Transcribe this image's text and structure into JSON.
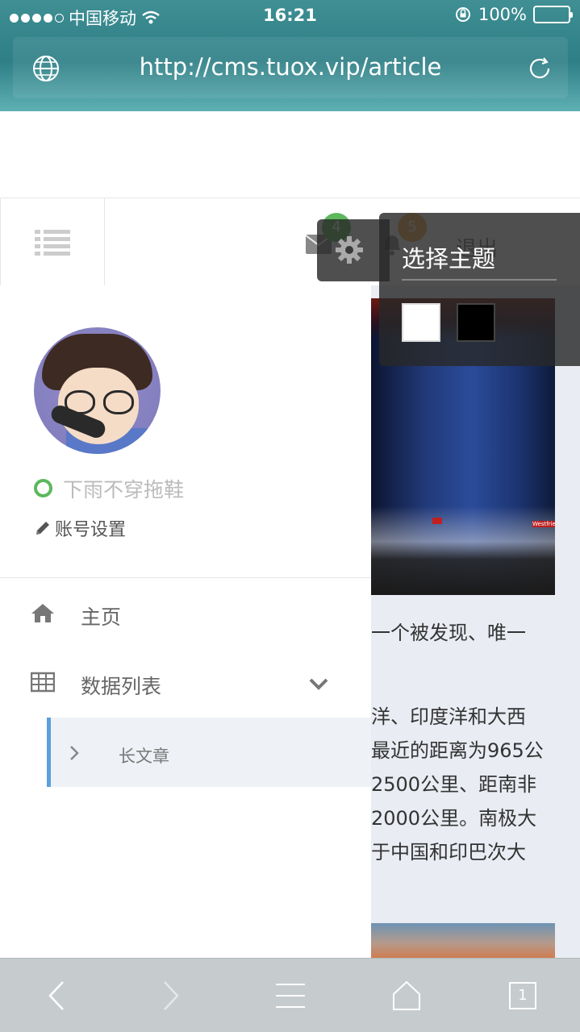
{
  "status_bar": {
    "carrier": "中国移动",
    "time": "16:21",
    "battery": "100%"
  },
  "url_bar": {
    "url": "http://cms.tuox.vip/article"
  },
  "topnav": {
    "mail_badge": "4",
    "bell_badge": "5",
    "logout_label": "退出"
  },
  "theme_popup": {
    "title": "选择主题",
    "swatches": [
      "#ffffff",
      "#000000"
    ]
  },
  "sidebar": {
    "username": "下雨不穿拖鞋",
    "account_settings": "账号设置",
    "items": [
      {
        "label": "主页",
        "icon": "home-icon"
      },
      {
        "label": "数据列表",
        "icon": "table-icon"
      }
    ],
    "subitems": [
      {
        "label": "长文章"
      }
    ]
  },
  "article": {
    "line1": "一个被发现、唯一",
    "line2": "洋、印度洋和大西",
    "line3": "最近的距离为965公",
    "line4": "2500公里、距南非",
    "line5": "2000公里。南极大",
    "line6": "于中国和印巴次大",
    "image_label": "Westfried"
  },
  "bottom_bar": {
    "tab_count": "1"
  },
  "colors": {
    "accent_blue": "#5aa0dd",
    "status_green": "#5cb85c",
    "badge_orange": "#f0ad4e",
    "safari_teal": "#2e7f86"
  }
}
